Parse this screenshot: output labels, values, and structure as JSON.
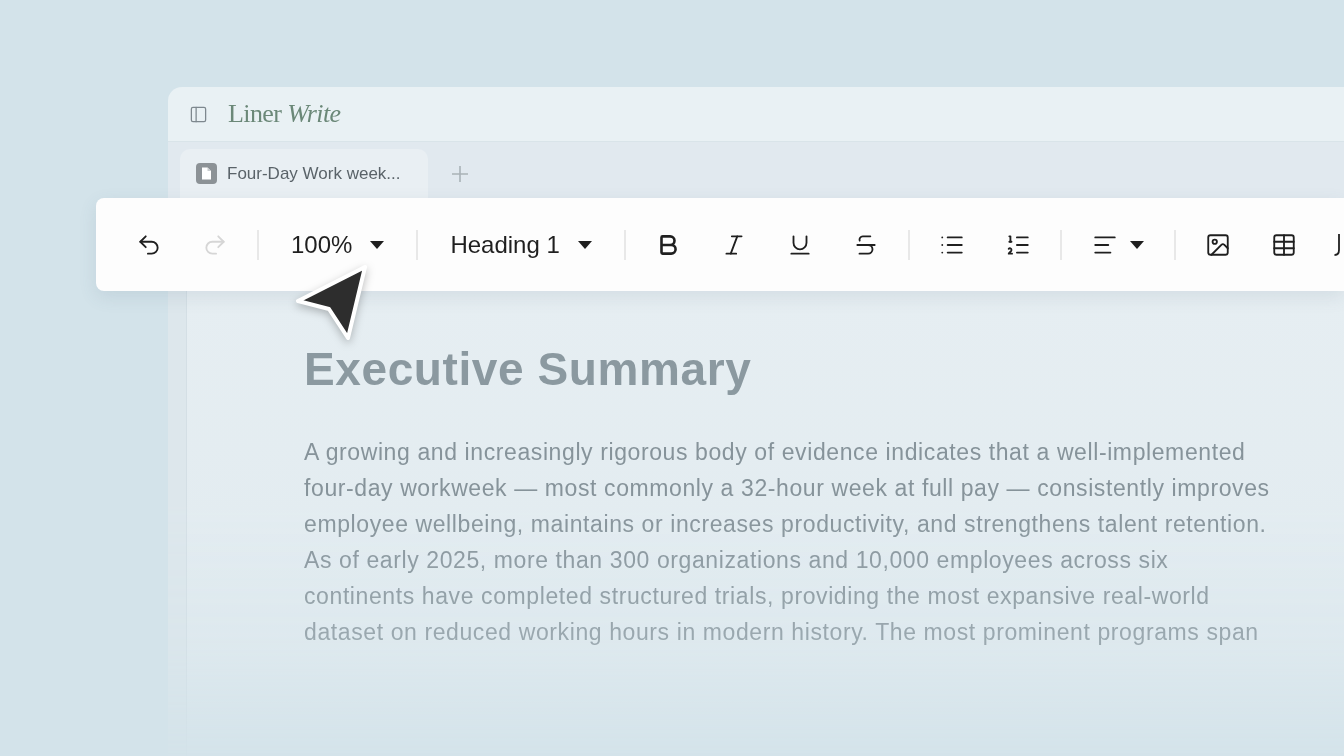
{
  "window": {
    "logo": "Liner *Write*"
  },
  "tabs": [
    {
      "label": "Four-Day Work week...",
      "selected": true
    }
  ],
  "toolbar": {
    "undo": {
      "disabled": false
    },
    "redo": {
      "disabled": true
    },
    "zoom": {
      "value": "100%"
    },
    "block_style": {
      "value": "Heading 1"
    }
  },
  "document": {
    "heading": "Executive Summary",
    "paragraph": "A growing and increasingly rigorous body of evidence indicates that a well-implemented four-day workweek — most commonly a 32-hour week at full pay — consistently improves employee wellbeing, maintains or increases productivity, and strengthens talent retention. As of early 2025, more than 300 organizations and 10,000 employees across six continents have completed structured trials, providing the most expansive real-world dataset on reduced working hours in modern history. The most prominent programs span"
  }
}
